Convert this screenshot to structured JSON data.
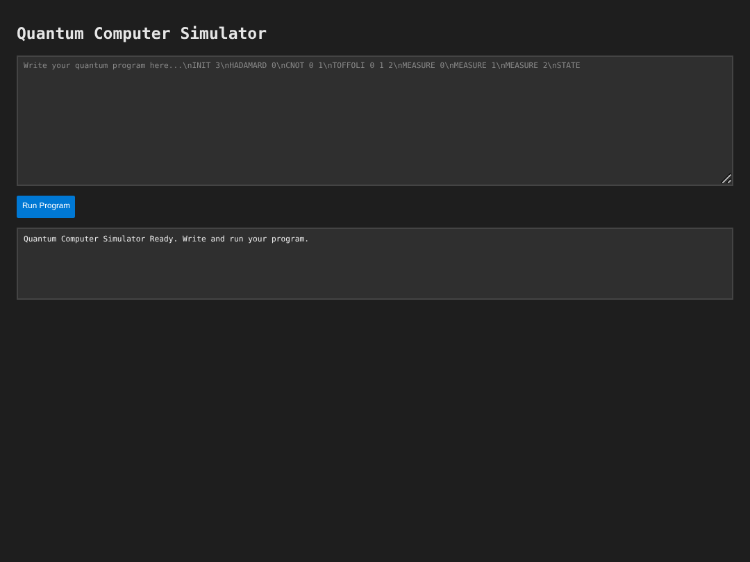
{
  "title": "Quantum Computer Simulator",
  "editor": {
    "placeholder": "Write your quantum program here...\\nINIT 3\\nHADAMARD 0\\nCNOT 0 1\\nTOFFOLI 0 1 2\\nMEASURE 0\\nMEASURE 1\\nMEASURE 2\\nSTATE"
  },
  "run_button": "Run Program",
  "output": "Quantum Computer Simulator Ready. Write and run your program."
}
